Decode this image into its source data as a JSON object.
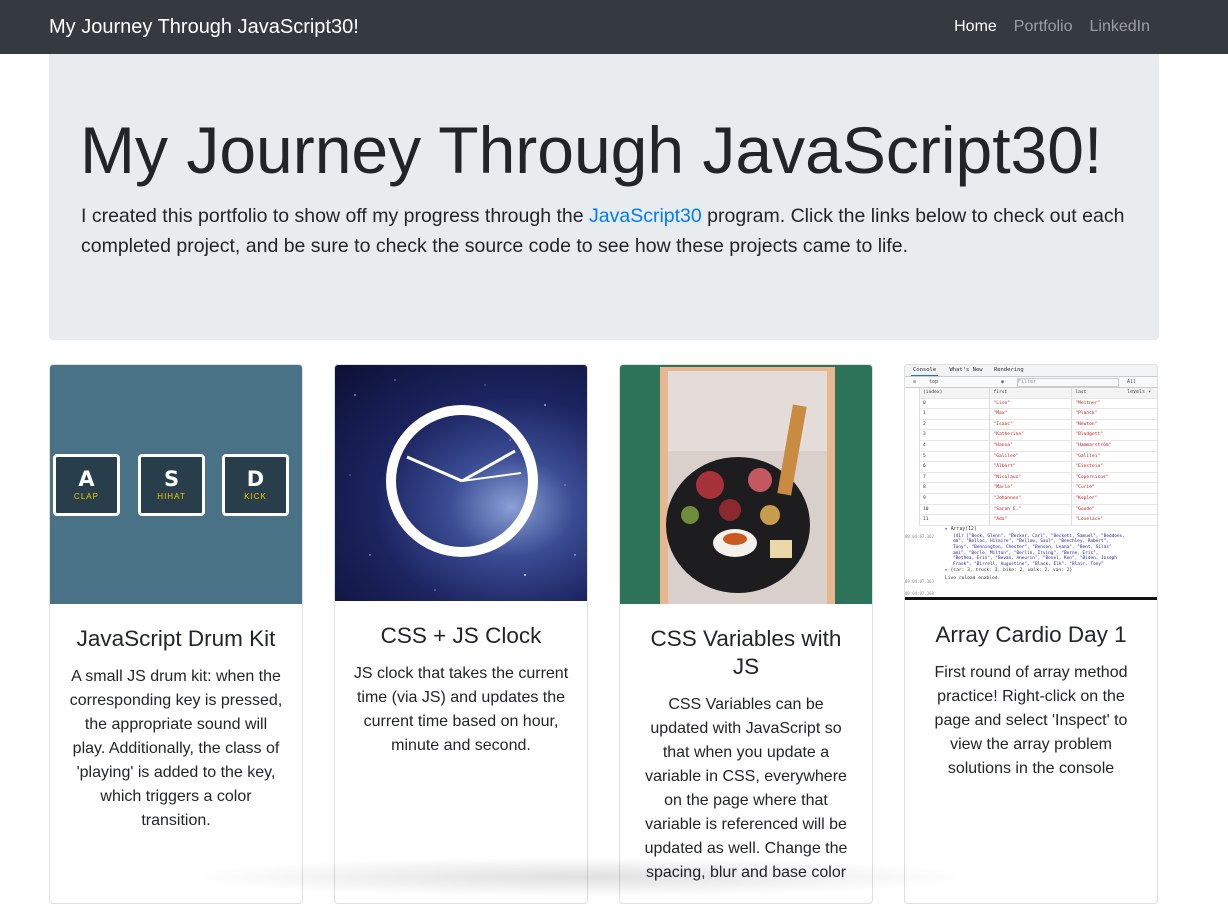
{
  "navbar": {
    "brand": "My Journey Through JavaScript30!",
    "links": [
      "Home",
      "Portfolio",
      "LinkedIn"
    ]
  },
  "jumbotron": {
    "title": "My Journey Through JavaScript30!",
    "lead_before": "I created this portfolio to show off my progress through the ",
    "lead_link": "JavaScript30",
    "lead_after": " program. Click the links below to check out each completed project, and be sure to check the source code to see how these projects came to life."
  },
  "cards": [
    {
      "title": "JavaScript Drum Kit",
      "text": "A small JS drum kit: when the corresponding key is pressed, the appropriate sound will play. Additionally, the class of 'playing' is added to the key, which triggers a color transition.",
      "keys": [
        {
          "key": "A",
          "sound": "CLAP"
        },
        {
          "key": "S",
          "sound": "HIHAT"
        },
        {
          "key": "D",
          "sound": "KICK"
        }
      ]
    },
    {
      "title": "CSS + JS Clock",
      "text": "JS clock that takes the current time (via JS) and updates the current time based on hour, minute and second."
    },
    {
      "title": "CSS Variables with JS",
      "text": "CSS Variables can be updated with JavaScript so that when you update a variable in CSS, everywhere on the page where that variable is referenced will be updated as well. Change the spacing, blur and base color"
    },
    {
      "title": "Array Cardio Day 1",
      "text": "First round of array method practice! Right-click on the page and select 'Inspect' to view the array problem solutions in the console",
      "console": {
        "tabs": [
          "Console",
          "What's New",
          "Rendering"
        ],
        "context": "top",
        "filter_placeholder": "Filter",
        "levels": "All levels ▾",
        "headers": [
          "(index)",
          "first",
          "last"
        ],
        "rows": [
          [
            "0",
            "\"Lise\"",
            "\"Meitner\""
          ],
          [
            "1",
            "\"Max\"",
            "\"Planck\""
          ],
          [
            "2",
            "\"Isaac\"",
            "\"Newton\""
          ],
          [
            "3",
            "\"Katherine\"",
            "\"Blodgett\""
          ],
          [
            "4",
            "\"Hanna\"",
            "\"Hammarström\""
          ],
          [
            "5",
            "\"Galileo\"",
            "\"Galilei\""
          ],
          [
            "6",
            "\"Albert\"",
            "\"Einstein\""
          ],
          [
            "7",
            "\"Nicolaus\"",
            "\"Copernicus\""
          ],
          [
            "8",
            "\"Marie\"",
            "\"Curie\""
          ],
          [
            "9",
            "\"Johannes\"",
            "\"Kepler\""
          ],
          [
            "10",
            "\"Sarah E.\"",
            "\"Goode\""
          ],
          [
            "11",
            "\"Ada\"",
            "\"Lovelace\""
          ]
        ],
        "array_line": "▸ Array(12)",
        "log_lines": [
          "(41) [\"Beck, Glenn\", \"Becker, Carl\", \"Beckett, Samuel\", \"Beddoes,",
          "em\", \"Belloc, Hilaire\", \"Bellow, Saul\", \"Benchley, Robert\",",
          "Tony\", \"Bennington, Chester\", \"Benson, Leana\", \"Bent, Silas\"",
          "ami\", \"Berle, Milton\", \"Berlin, Irving\", \"Berne, Eric\",",
          "\"Bethea, Erin\", \"Bevan, Aneurin\", \"Bevel, Ken\", \"Biden, Joseph",
          "Frank\", \"Birrell, Augustine\", \"Black, Elk\", \"Blair, Tony\""
        ],
        "object_line": "▸ {car: 3, truck: 3, bike: 2, walk: 2, van: 2}",
        "reload_line": "Live reload enabled.",
        "times": [
          "09:04:07.362",
          "09:04:07.363",
          "09:04:07.368"
        ]
      }
    }
  ]
}
